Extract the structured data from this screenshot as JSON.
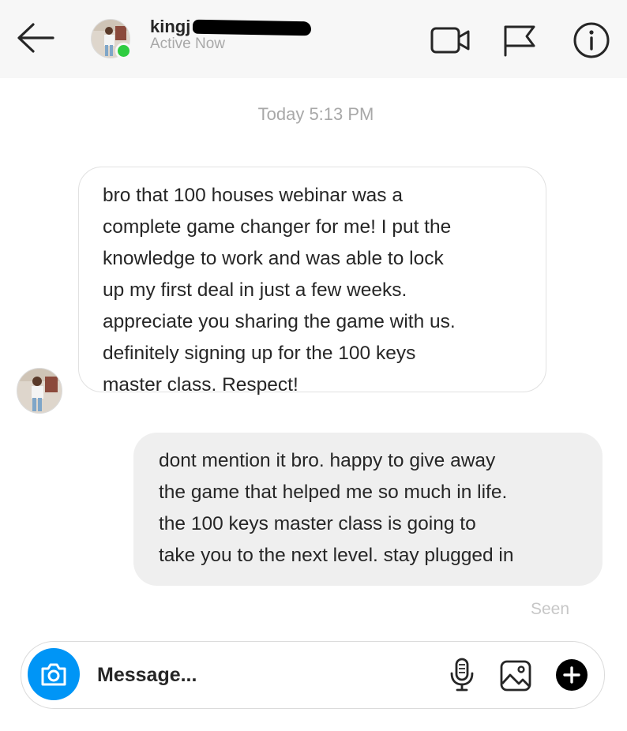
{
  "header": {
    "username": "kingj",
    "status": "Active Now"
  },
  "conversation": {
    "timestamp": "Today 5:13 PM",
    "messages": [
      {
        "sender": "other",
        "text": "bro that 100 houses webinar was a\ncomplete game changer for me! I put the\nknowledge to work and was able to lock\nup my first deal in just a few weeks.\nappreciate you sharing the game with us.\ndefinitely signing up for the 100 keys\nmaster class. Respect!"
      },
      {
        "sender": "self",
        "text": "dont mention it bro. happy to give away\nthe game that helped me so much in life.\nthe 100 keys master class is going to\ntake you to the next level. stay plugged in"
      }
    ],
    "seen_label": "Seen"
  },
  "composer": {
    "placeholder": "Message..."
  },
  "colors": {
    "accent": "#0095f6",
    "online": "#2ecc40",
    "incoming_bubble_border": "#e1e1e1",
    "outgoing_bubble": "#efefef",
    "muted_text": "#a8a8a8"
  },
  "icons": [
    "back-arrow-icon",
    "video-call-icon",
    "flag-icon",
    "info-icon",
    "camera-icon",
    "microphone-icon",
    "image-icon",
    "plus-icon"
  ]
}
